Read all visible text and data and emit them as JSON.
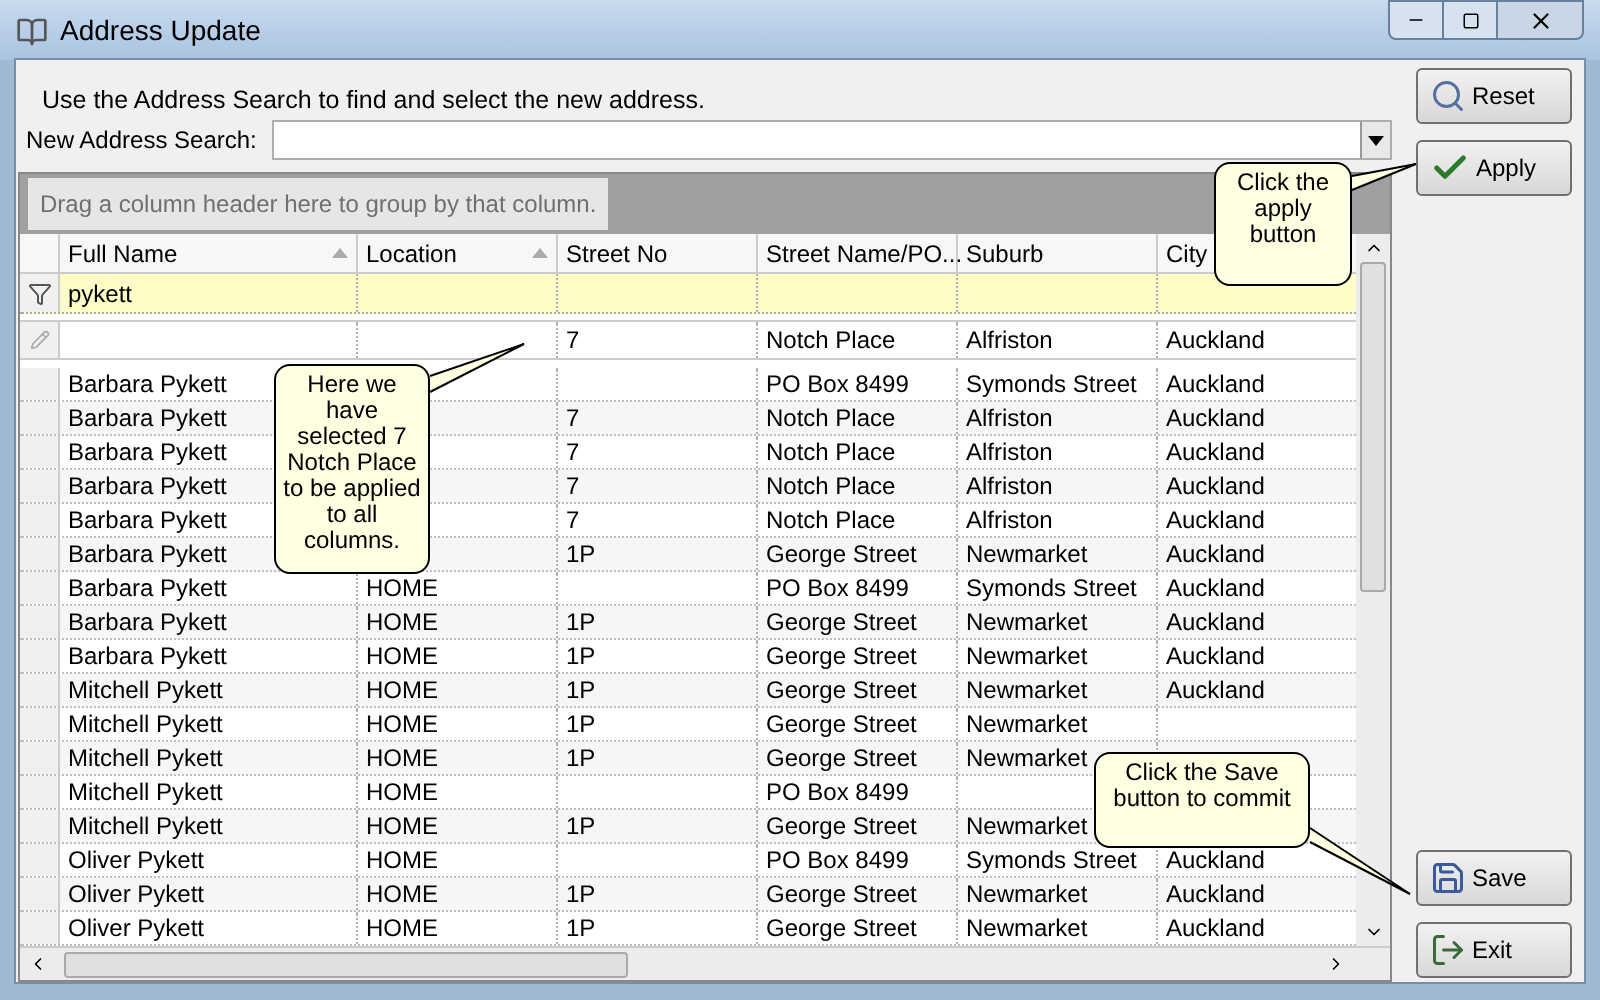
{
  "window": {
    "title": "Address Update"
  },
  "instructions": "Use the Address Search to find and select the new address.",
  "search": {
    "label": "New Address Search:"
  },
  "group_panel": "Drag a column header here to group by that column.",
  "table": {
    "columns": [
      {
        "label": "Full Name",
        "sorted": true
      },
      {
        "label": "Location",
        "sorted": true
      },
      {
        "label": "Street No",
        "sorted": false
      },
      {
        "label": "Street Name/PO...",
        "sorted": false
      },
      {
        "label": "Suburb",
        "sorted": false
      },
      {
        "label": "City",
        "sorted": false
      }
    ],
    "filter_row": {
      "full_name": "pykett"
    },
    "new_row": {
      "street_no": "7",
      "street_name": "Notch Place",
      "suburb": "Alfriston",
      "city": "Auckland"
    },
    "rows": [
      [
        "Barbara Pykett",
        null,
        null,
        "PO Box 8499",
        "Symonds Street",
        "Auckland"
      ],
      [
        "Barbara Pykett",
        null,
        "7",
        "Notch Place",
        "Alfriston",
        "Auckland"
      ],
      [
        "Barbara Pykett",
        null,
        "7",
        "Notch Place",
        "Alfriston",
        "Auckland"
      ],
      [
        "Barbara Pykett",
        null,
        "7",
        "Notch Place",
        "Alfriston",
        "Auckland"
      ],
      [
        "Barbara Pykett",
        null,
        "7",
        "Notch Place",
        "Alfriston",
        "Auckland"
      ],
      [
        "Barbara Pykett",
        null,
        "1P",
        "George Street",
        "Newmarket",
        "Auckland"
      ],
      [
        "Barbara Pykett",
        "HOME",
        null,
        "PO Box 8499",
        "Symonds Street",
        "Auckland"
      ],
      [
        "Barbara Pykett",
        "HOME",
        "1P",
        "George Street",
        "Newmarket",
        "Auckland"
      ],
      [
        "Barbara Pykett",
        "HOME",
        "1P",
        "George Street",
        "Newmarket",
        "Auckland"
      ],
      [
        "Mitchell  Pykett",
        "HOME",
        "1P",
        "George Street",
        "Newmarket",
        "Auckland"
      ],
      [
        "Mitchell  Pykett",
        "HOME",
        "1P",
        "George Street",
        "Newmarket",
        null
      ],
      [
        "Mitchell  Pykett",
        "HOME",
        "1P",
        "George Street",
        "Newmarket",
        null
      ],
      [
        "Mitchell  Pykett",
        "HOME",
        null,
        "PO Box 8499",
        null,
        null
      ],
      [
        "Mitchell  Pykett",
        "HOME",
        "1P",
        "George Street",
        "Newmarket",
        null
      ],
      [
        "Oliver Pykett",
        "HOME",
        null,
        "PO Box 8499",
        "Symonds Street",
        "Auckland"
      ],
      [
        "Oliver Pykett",
        "HOME",
        "1P",
        "George Street",
        "Newmarket",
        "Auckland"
      ],
      [
        "Oliver Pykett",
        "HOME",
        "1P",
        "George Street",
        "Newmarket",
        "Auckland"
      ]
    ]
  },
  "buttons": [
    {
      "label": "Reset",
      "kind": "reset"
    },
    {
      "label": "Apply",
      "kind": "apply"
    },
    {
      "label": "Save",
      "kind": "save"
    },
    {
      "label": "Exit",
      "kind": "exit"
    }
  ],
  "callouts": [
    {
      "text": "Here we have selected 7 Notch Place to be applied to all columns.",
      "kind": "grid"
    },
    {
      "text": "Click the apply button",
      "kind": "apply"
    },
    {
      "text": "Click the Save button to commit",
      "kind": "save"
    }
  ]
}
